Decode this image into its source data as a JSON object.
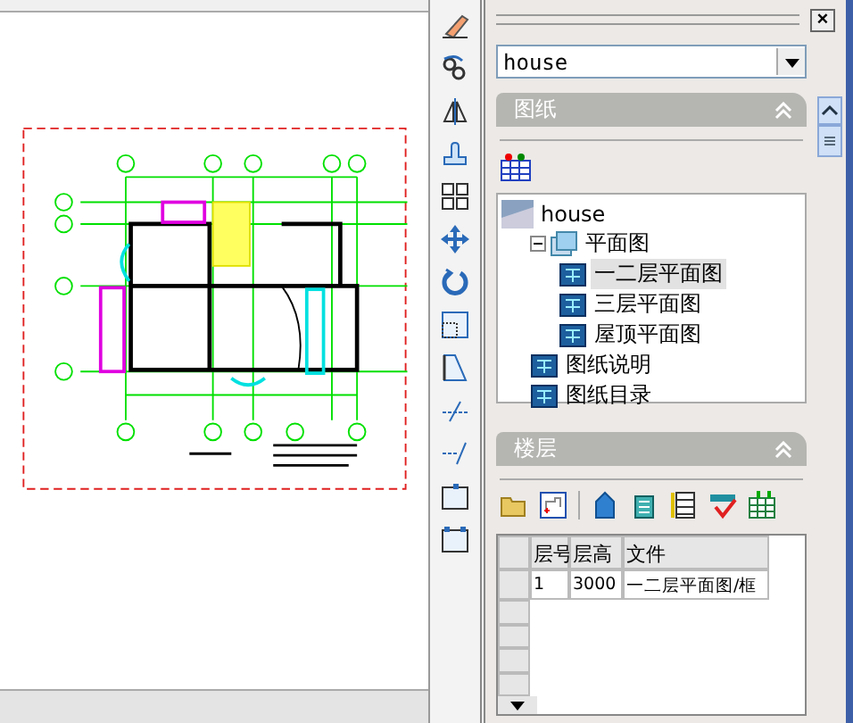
{
  "combo": {
    "value": "house"
  },
  "drawings": {
    "title": "图纸",
    "expanded": true,
    "tree": {
      "label": "house",
      "kind": "project",
      "children": [
        {
          "label": "平面图",
          "kind": "folder",
          "expanded": true,
          "selected": false,
          "children": [
            {
              "label": "一二层平面图",
              "kind": "sheet",
              "selected": true
            },
            {
              "label": "三层平面图",
              "kind": "sheet",
              "selected": false
            },
            {
              "label": "屋顶平面图",
              "kind": "sheet",
              "selected": false
            }
          ]
        },
        {
          "label": "图纸说明",
          "kind": "sheet",
          "selected": false
        },
        {
          "label": "图纸目录",
          "kind": "sheet",
          "selected": false
        }
      ]
    }
  },
  "floors": {
    "title": "楼层",
    "expanded": true,
    "table": {
      "columns": [
        "层号",
        "层高",
        "文件"
      ],
      "rows": [
        [
          "1",
          "3000",
          "一二层平面图/框"
        ],
        [],
        [],
        [],
        []
      ]
    }
  },
  "close_label": "×",
  "tools": [
    {
      "kind": "eraser"
    },
    {
      "kind": "copy"
    },
    {
      "kind": "mirror"
    },
    {
      "kind": "offset"
    },
    {
      "kind": "array"
    },
    {
      "kind": "move"
    },
    {
      "kind": "rotate"
    },
    {
      "kind": "scale"
    },
    {
      "kind": "stretch"
    },
    {
      "kind": "trim"
    },
    {
      "kind": "extend"
    },
    {
      "kind": "box"
    },
    {
      "kind": "corners"
    }
  ]
}
